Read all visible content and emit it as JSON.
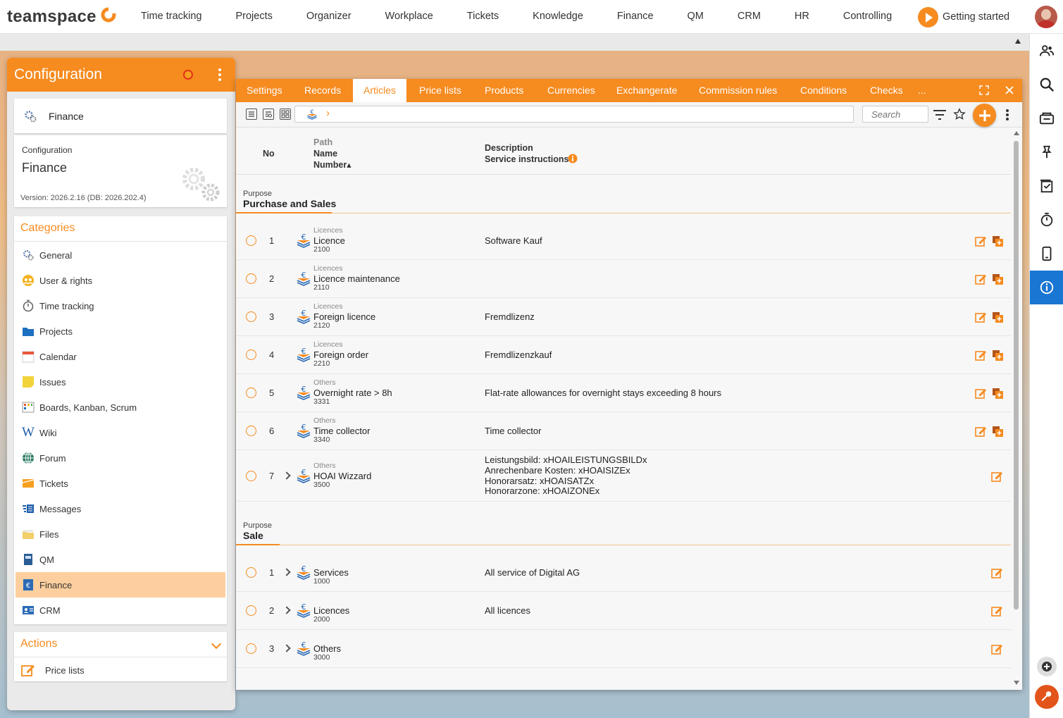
{
  "brand": {
    "name": "teamspace"
  },
  "topnav": [
    "Time tracking",
    "Projects",
    "Organizer",
    "Workplace",
    "Tickets",
    "Knowledge",
    "Finance",
    "QM",
    "CRM",
    "HR",
    "Controlling"
  ],
  "getting_started": "Getting started",
  "config": {
    "title": "Configuration",
    "finance_label": "Finance",
    "info_small": "Configuration",
    "info_big": "Finance",
    "version": "Version: 2026.2.16 (DB: 2026.202.4)",
    "categories_title": "Categories",
    "categories": [
      {
        "label": "General",
        "icon": "gear-icon"
      },
      {
        "label": "User & rights",
        "icon": "users-icon"
      },
      {
        "label": "Time tracking",
        "icon": "stopwatch-icon"
      },
      {
        "label": "Projects",
        "icon": "folder-icon"
      },
      {
        "label": "Calendar",
        "icon": "calendar-icon"
      },
      {
        "label": "Issues",
        "icon": "sticky-note-icon"
      },
      {
        "label": "Boards, Kanban, Scrum",
        "icon": "board-icon"
      },
      {
        "label": "Wiki",
        "icon": "wiki-icon"
      },
      {
        "label": "Forum",
        "icon": "globe-icon"
      },
      {
        "label": "Tickets",
        "icon": "ticket-icon"
      },
      {
        "label": "Messages",
        "icon": "messages-icon"
      },
      {
        "label": "Files",
        "icon": "files-icon"
      },
      {
        "label": "QM",
        "icon": "qm-book-icon"
      },
      {
        "label": "Finance",
        "icon": "euro-icon",
        "active": true
      },
      {
        "label": "CRM",
        "icon": "contact-card-icon"
      }
    ],
    "actions_title": "Actions",
    "actions": [
      {
        "label": "Price lists",
        "icon": "edit-icon"
      }
    ]
  },
  "tabs": [
    "Settings",
    "Records",
    "Articles",
    "Price lists",
    "Products",
    "Currencies",
    "Exchangerate",
    "Commission rules",
    "Conditions",
    "Checks",
    "..."
  ],
  "active_tab": "Articles",
  "search_placeholder": "Search",
  "breadcrumb_sep": "›",
  "columns": {
    "no": "No",
    "path": "Path",
    "name": "Name",
    "number": "Number▴",
    "description": "Description",
    "service_instructions": "Service instructions"
  },
  "groups": [
    {
      "small": "Purpose",
      "title": "Purchase and Sales",
      "rows": [
        {
          "no": "1",
          "path": "Licences",
          "name": "Licence",
          "number": "2100",
          "desc": [
            "Software Kauf"
          ]
        },
        {
          "no": "2",
          "path": "Licences",
          "name": "Licence maintenance",
          "number": "2110",
          "desc": []
        },
        {
          "no": "3",
          "path": "Licences",
          "name": "Foreign licence",
          "number": "2120",
          "desc": [
            "Fremdlizenz"
          ]
        },
        {
          "no": "4",
          "path": "Licences",
          "name": "Foreign order",
          "number": "2210",
          "desc": [
            "Fremdlizenzkauf"
          ]
        },
        {
          "no": "5",
          "path": "Others",
          "name": "Overnight rate > 8h",
          "number": "3331",
          "desc": [
            "Flat-rate allowances for overnight stays exceeding 8 hours"
          ]
        },
        {
          "no": "6",
          "path": "Others",
          "name": "Time collector",
          "number": "3340",
          "desc": [
            "Time collector"
          ]
        },
        {
          "no": "7",
          "path": "Others",
          "name": "HOAI Wizzard",
          "number": "3500",
          "desc": [
            "Leistungsbild: xHOAILEISTUNGSBILDx",
            "Anrechenbare Kosten: xHOAISIZEx",
            "Honorarsatz: xHOAISATZx",
            "Honorarzone: xHOAIZONEx"
          ]
        }
      ]
    },
    {
      "small": "Purpose",
      "title": "Sale",
      "rows": [
        {
          "no": "1",
          "path": "",
          "name": "Services",
          "number": "1000",
          "desc": [
            "All service of Digital AG"
          ]
        },
        {
          "no": "2",
          "path": "",
          "name": "Licences",
          "number": "2000",
          "desc": [
            "All licences"
          ]
        },
        {
          "no": "3",
          "path": "",
          "name": "Others",
          "number": "3000",
          "desc": []
        }
      ]
    }
  ],
  "colors": {
    "accent": "#f68b1f",
    "active_blue": "#1976d2",
    "active_category": "#fdcf9e"
  }
}
